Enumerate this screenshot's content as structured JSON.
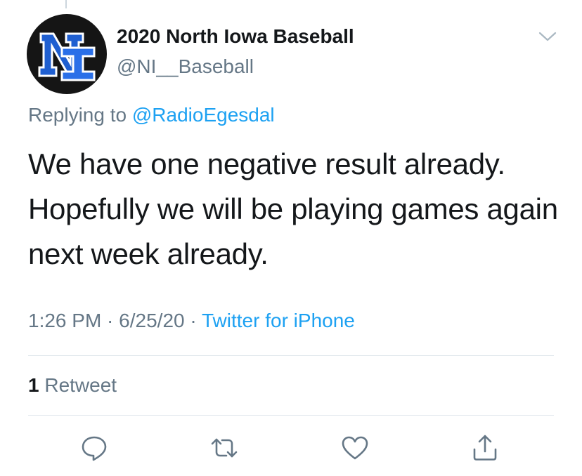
{
  "tweet": {
    "author": {
      "display_name": "2020 North Iowa Baseball",
      "handle": "@NI__Baseball",
      "avatar_logo": "NI"
    },
    "replying_prefix": "Replying to ",
    "replying_to": "@RadioEgesdal",
    "text": "We have one negative result already. Hopefully we will be playing games again next week already.",
    "time": "1:26 PM",
    "date": "6/25/20",
    "separator": " · ",
    "source": "Twitter for iPhone",
    "retweet_count": "1",
    "retweet_label": " Retweet"
  },
  "icons": {
    "menu": "chevron-down-icon",
    "reply": "reply-icon",
    "retweet": "retweet-icon",
    "like": "heart-icon",
    "share": "share-icon"
  },
  "colors": {
    "link": "#1da1f2",
    "secondary_text": "#657786",
    "primary_text": "#14171a",
    "divider": "#e1e8ed",
    "avatar_bg": "#151515",
    "logo_blue": "#1f5fd1"
  }
}
